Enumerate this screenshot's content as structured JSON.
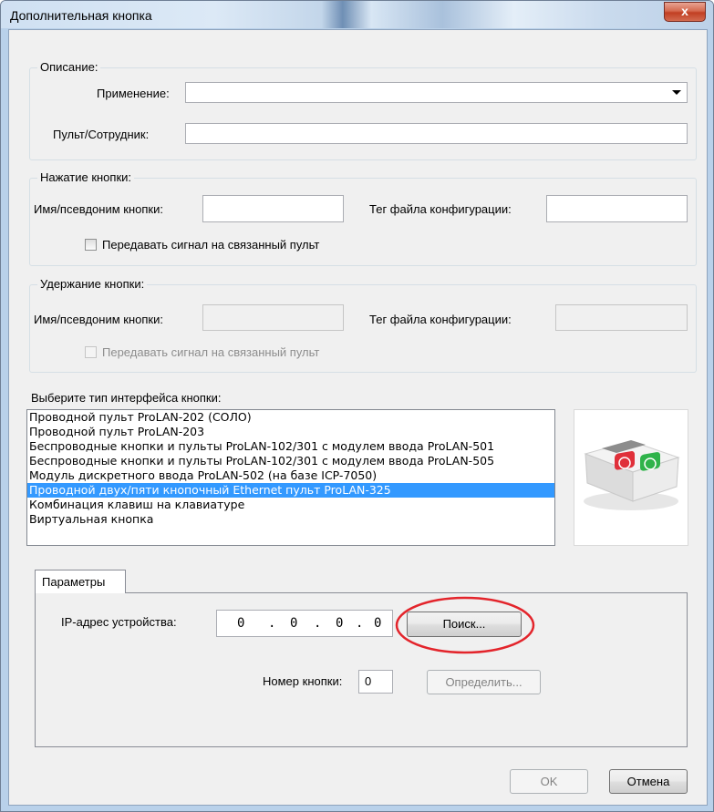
{
  "window": {
    "title": "Дополнительная кнопка",
    "close_glyph": "x"
  },
  "description_group": {
    "label": "Описание:",
    "application_label": "Применение:",
    "application_value": "",
    "remote_label": "Пульт/Сотрудник:",
    "remote_value": ""
  },
  "press_group": {
    "label": "Нажатие кнопки:",
    "alias_label": "Имя/псевдоним кнопки:",
    "alias_value": "",
    "tag_label": "Тег файла конфигурации:",
    "tag_value": "",
    "checkbox_label": "Передавать сигнал на связанный пульт",
    "checkbox_checked": false
  },
  "hold_group": {
    "label": "Удержание кнопки:",
    "alias_label": "Имя/псевдоним кнопки:",
    "tag_label": "Тег файла конфигурации:",
    "checkbox_label": "Передавать сигнал на связанный пульт",
    "checkbox_checked": false
  },
  "interface": {
    "label": "Выберите тип интерфейса кнопки:",
    "items": [
      "Проводной пульт ProLAN-202 (СОЛО)",
      "Проводной пульт ProLAN-203",
      "Беспроводные кнопки и пульты ProLAN-102/301 с модулем ввода ProLAN-501",
      "Беспроводные кнопки и пульты ProLAN-102/301 с модулем ввода ProLAN-505",
      "Модуль дискретного ввода ProLAN-502 (на базе ICP-7050)",
      "Проводной двух/пяти кнопочный Ethernet пульт ProLAN-325",
      "Комбинация клавиш на клавиатуре",
      "Виртуальная кнопка"
    ],
    "selected_index": 5
  },
  "params": {
    "tab_label": "Параметры",
    "ip_label": "IP-адрес устройства:",
    "ip_octets": [
      "0",
      "0",
      "0",
      "0"
    ],
    "ip_dot": ".",
    "search_button": "Поиск...",
    "button_number_label": "Номер кнопки:",
    "button_number_value": "0",
    "detect_button": "Определить..."
  },
  "footer": {
    "ok_button": "OK",
    "cancel_button": "Отмена"
  },
  "colors": {
    "selection": "#3399ff",
    "highlight_circle": "#e3242b",
    "device_red": "#e0303a",
    "device_green": "#2fb34a"
  }
}
